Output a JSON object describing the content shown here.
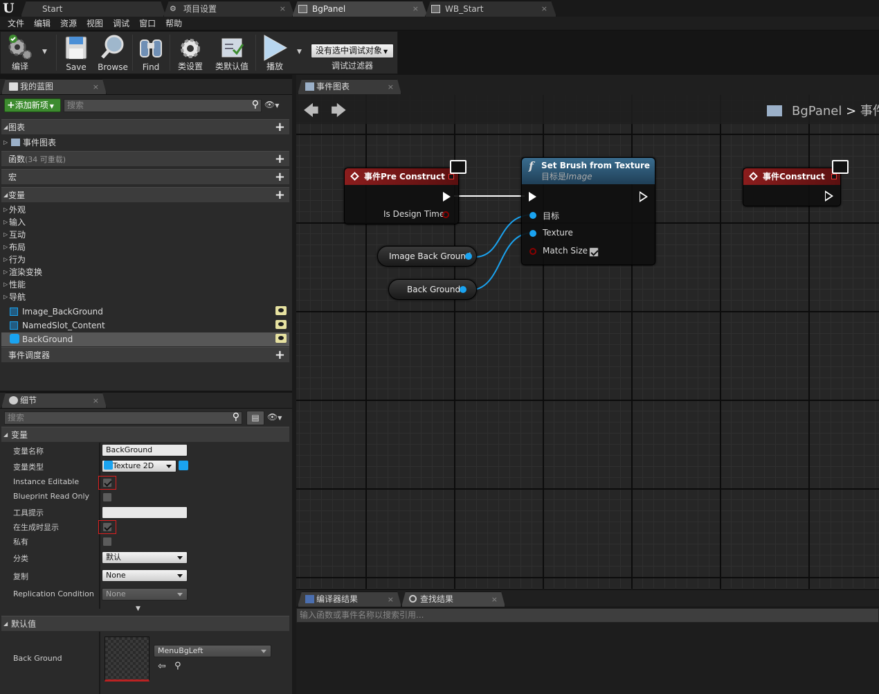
{
  "doc_tabs": [
    {
      "label": "Start"
    },
    {
      "label": "项目设置"
    },
    {
      "label": "BgPanel"
    },
    {
      "label": "WB_Start"
    }
  ],
  "close_glyph": "×",
  "menu": [
    "文件",
    "编辑",
    "资源",
    "视图",
    "调试",
    "窗口",
    "帮助"
  ],
  "toolbar": {
    "compile": "编译",
    "save": "Save",
    "browse": "Browse",
    "find": "Find",
    "class_settings": "类设置",
    "class_defaults": "类默认值",
    "play": "播放",
    "debug_target": "没有选中调试对象",
    "debug_filter": "调试过滤器"
  },
  "my_blueprint": {
    "tab": "我的蓝图",
    "add_new": "添加新项",
    "search_placeholder": "搜索",
    "graphs": "图表",
    "event_graph": "事件图表",
    "functions": "函数",
    "functions_count": "(34 可重载)",
    "macros": "宏",
    "variables": "变量",
    "var_categories": [
      "外观",
      "输入",
      "互动",
      "布局",
      "行为",
      "渲染变换",
      "性能",
      "导航"
    ],
    "var_items": [
      "Image_BackGround",
      "NamedSlot_Content",
      "BackGround"
    ],
    "event_dispatchers": "事件调度器"
  },
  "details": {
    "tab": "细节",
    "search_placeholder": "搜索",
    "section_variable": "变量",
    "var_name_label": "变量名称",
    "var_name_value": "BackGround",
    "var_type_label": "变量类型",
    "var_type_value": "Texture 2D",
    "instance_editable_label": "Instance Editable",
    "instance_editable": true,
    "bp_readonly_label": "Blueprint Read Only",
    "bp_readonly": false,
    "tooltip_label": "工具提示",
    "tooltip_value": "",
    "expose_spawn_label": "在生成时显示",
    "expose_spawn": true,
    "private_label": "私有",
    "private": false,
    "category_label": "分类",
    "category_value": "默认",
    "replication_label": "复制",
    "replication_value": "None",
    "rep_condition_label": "Replication Condition",
    "rep_condition_value": "None",
    "section_default": "默认值",
    "background_label": "Back Ground",
    "background_asset": "MenuBgLeft"
  },
  "graph": {
    "tab": "事件图表",
    "breadcrumb_root": "BgPanel",
    "breadcrumb_sep": ">",
    "breadcrumb_child": "事件",
    "node_preconstruct": {
      "title": "事件Pre Construct",
      "pin_design": "Is Design Time"
    },
    "node_setbrush": {
      "title": "Set Brush from Texture",
      "subtitle_prefix": "目标是",
      "subtitle_target": "Image",
      "pin_target": "目标",
      "pin_texture": "Texture",
      "pin_matchsize": "Match Size",
      "match_size": true
    },
    "node_construct": {
      "title": "事件Construct"
    },
    "var_image": "Image Back Ground",
    "var_background": "Back Ground"
  },
  "bottom": {
    "tab_compiler": "编译器结果",
    "tab_find": "查找结果",
    "search_placeholder": "输入函数或事件名称以搜索引用..."
  },
  "colors": {
    "event_node": "#8b1d1d",
    "function_node": "#3a6d8f",
    "object_pin": "#1aa3f0",
    "bool_pin": "#8a0000",
    "accent_green": "#3d8b2f"
  }
}
